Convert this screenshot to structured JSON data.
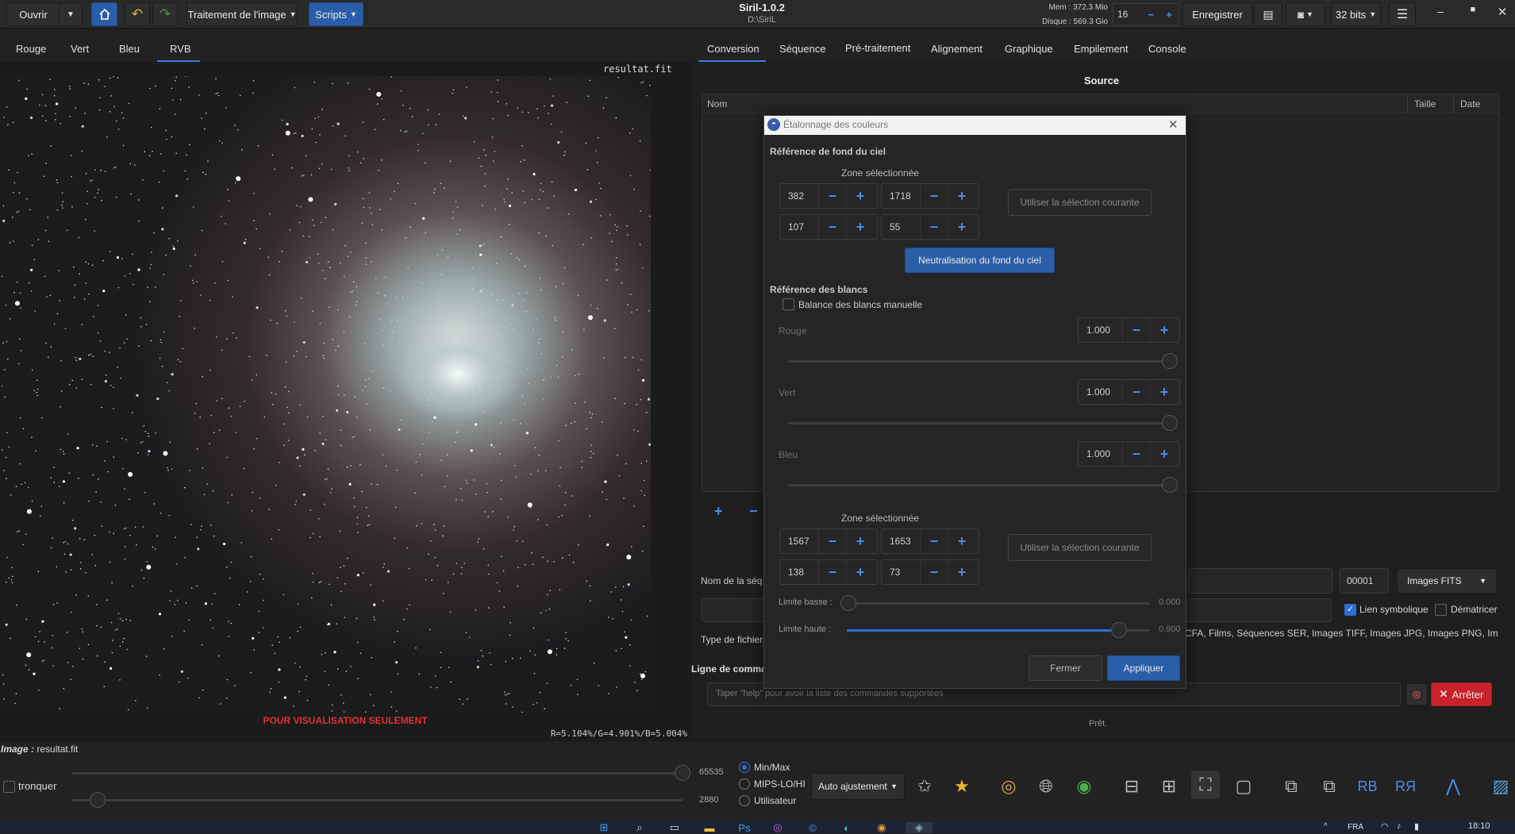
{
  "toolbar": {
    "open_label": "Ouvrir",
    "image_processing_label": "Traitement de l'image",
    "scripts_label": "Scripts",
    "app_title": "Siril-1.0.2",
    "app_path": "D:\\SiriL",
    "mem_label": "Mem : 372.3 Mio",
    "disk_label": "Disque : 569.3 Gio",
    "threads_value": "16",
    "save_label": "Enregistrer",
    "bits_label": "32 bits"
  },
  "channel_tabs": [
    "Rouge",
    "Vert",
    "Bleu",
    "RVB"
  ],
  "active_channel": "RVB",
  "viewer": {
    "filename_overlay": "resultat.fit",
    "preview_warning": "POUR VISUALISATION SEULEMENT",
    "rgb_stats": "R=5.104%/G=4.901%/B=5.004%"
  },
  "right_tabs": [
    "Conversion",
    "Séquence",
    "Pré-traitement",
    "Alignement",
    "Graphique",
    "Empilement",
    "Console"
  ],
  "active_right_tab": "Conversion",
  "conversion": {
    "source_label": "Source",
    "col_name": "Nom",
    "col_size": "Taille",
    "col_date": "Date",
    "sequence_name_label": "Nom de la séq",
    "seq_index": "00001",
    "output_format": "Images FITS",
    "symlink_label": "Lien symbolique",
    "debayer_label": "Dématricer",
    "filetype_label": "Type de fichiers",
    "filetype_values": "CFA, Films, Séquences SER, Images TIFF, Images JPG, Images PNG, Images"
  },
  "command": {
    "title": "Ligne de commar",
    "placeholder": "Taper \"help\" pour avoir la liste des commandes supportées",
    "stop_label": "Arrêter",
    "status": "Prêt."
  },
  "bottom": {
    "image_label": "Image :",
    "image_name": "resultat.fit",
    "clip_label": "tronquer",
    "max_value": "65535",
    "min_value": "2880",
    "mode_minmax": "Min/Max",
    "mode_mips": "MIPS-LO/HI",
    "mode_user": "Utilisateur",
    "stretch_label": "Auto ajustement"
  },
  "dialog": {
    "title": "Étalonnage des couleurs",
    "bg_section": "Référence de fond du ciel",
    "zone_label": "Zone sélectionnée",
    "bg_x": "382",
    "bg_y": "1718",
    "bg_w": "107",
    "bg_h": "55",
    "use_selection_label": "Utiliser la sélection courante",
    "neutralize_label": "Neutralisation du fond du ciel",
    "white_section": "Référence des blancs",
    "manual_wb_label": "Balance des blancs manuelle",
    "red_label": "Rouge",
    "green_label": "Vert",
    "blue_label": "Bleu",
    "red_value": "1.000",
    "green_value": "1.000",
    "blue_value": "1.000",
    "wh_x": "1567",
    "wh_y": "1653",
    "wh_w": "138",
    "wh_h": "73",
    "low_limit_label": "Limite basse :",
    "low_limit_value": "0.000",
    "high_limit_label": "Limite haute :",
    "high_limit_value": "0.900",
    "close_label": "Fermer",
    "apply_label": "Appliquer"
  },
  "taskbar": {
    "lang": "FRA",
    "time": "18:10"
  },
  "colors": {
    "accent": "#2b5ea8",
    "stop_red": "#c8232c",
    "warning_red": "#e03030",
    "plus_blue": "#4a8de8"
  }
}
